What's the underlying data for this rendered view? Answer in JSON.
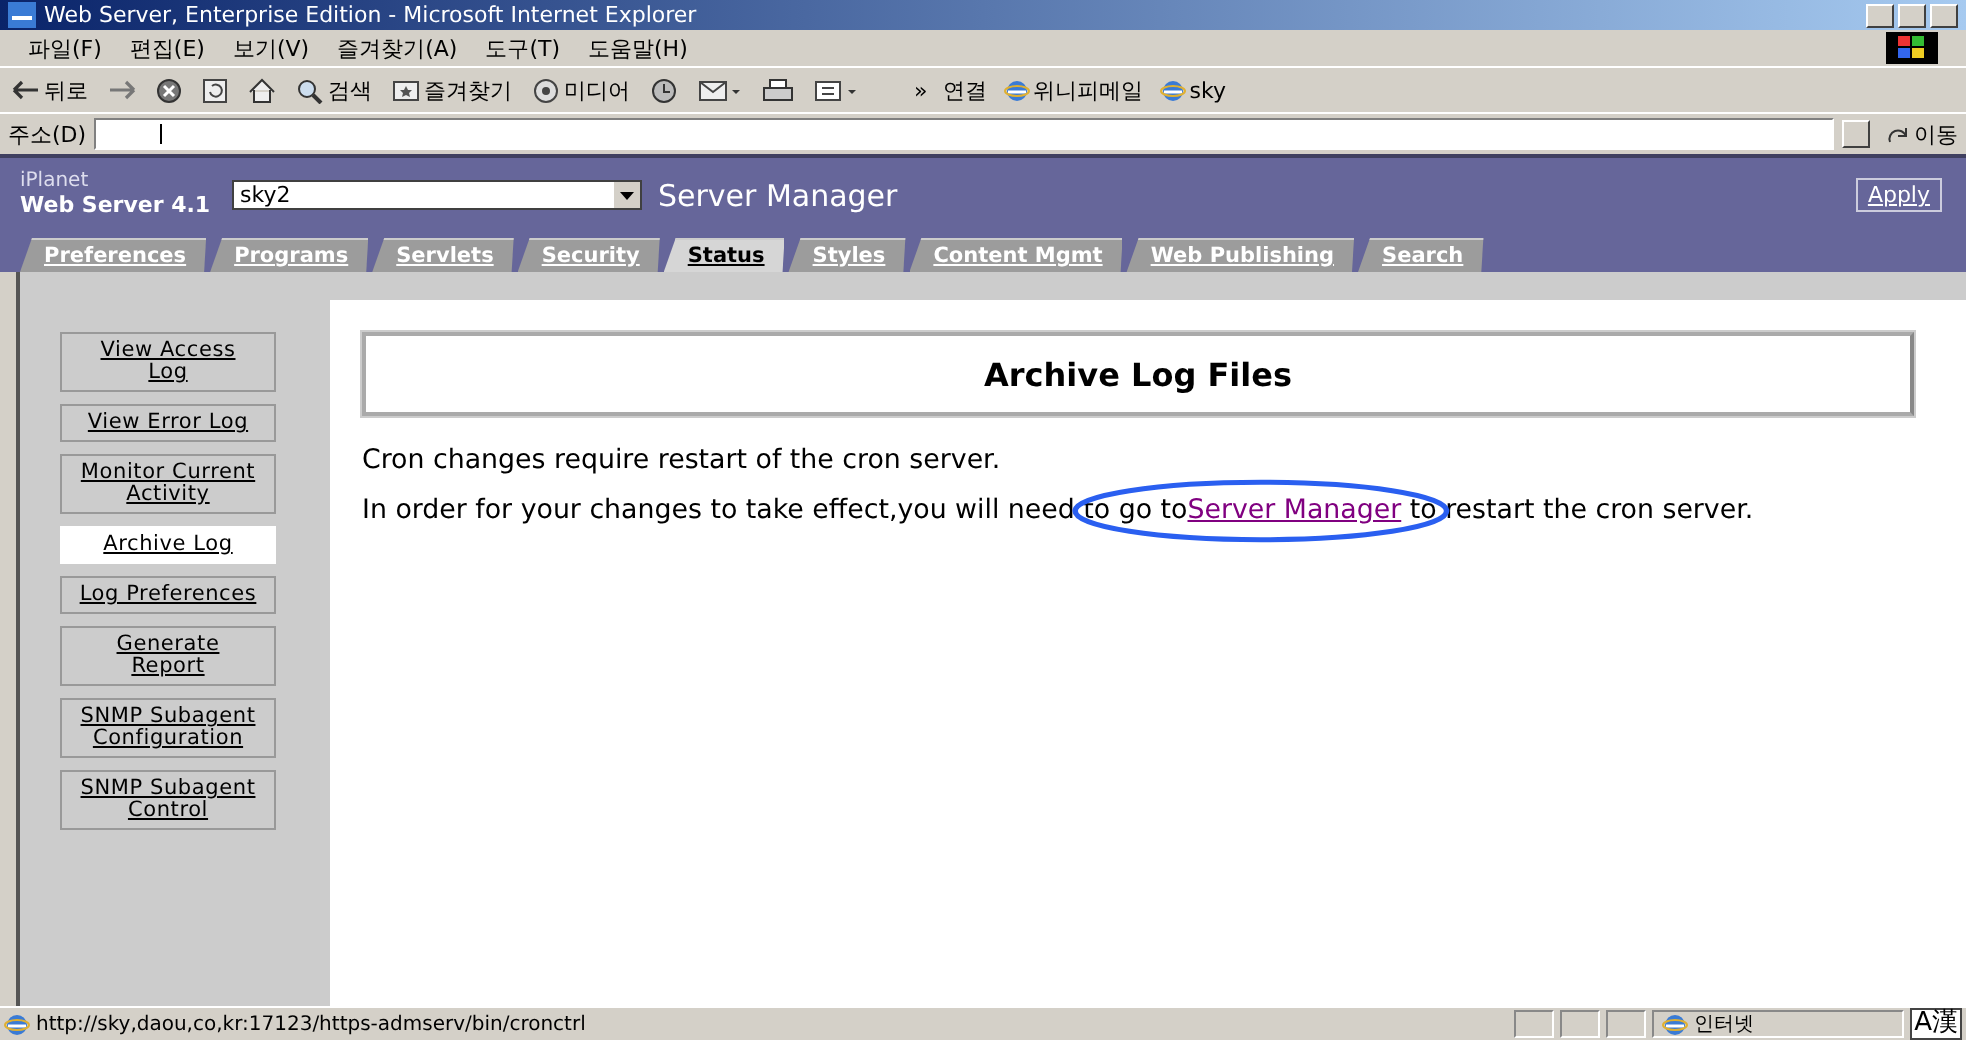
{
  "window": {
    "title": "Web Server, Enterprise Edition - Microsoft Internet Explorer"
  },
  "menu": [
    "파일(F)",
    "편집(E)",
    "보기(V)",
    "즐겨찾기(A)",
    "도구(T)",
    "도움말(H)"
  ],
  "toolbar": [
    {
      "kind": "back",
      "label": "뒤로"
    },
    {
      "kind": "forward"
    },
    {
      "kind": "stop"
    },
    {
      "kind": "refresh"
    },
    {
      "kind": "home"
    },
    {
      "kind": "search",
      "label": "검색"
    },
    {
      "kind": "favorites",
      "label": "즐겨찾기"
    },
    {
      "kind": "media",
      "label": "미디어"
    },
    {
      "kind": "history"
    },
    {
      "kind": "mail"
    },
    {
      "kind": "print"
    },
    {
      "kind": "edit"
    }
  ],
  "links": {
    "chevron": "»",
    "label": "연결",
    "items": [
      "위니피메일",
      "sky"
    ]
  },
  "address": {
    "label": "주소(D)",
    "go": "이동"
  },
  "header": {
    "brand": "iPlanet",
    "product": "Web Server 4.1",
    "server": "sky2",
    "title": "Server Manager",
    "apply": "Apply"
  },
  "tabs": [
    {
      "label": "Preferences",
      "selected": false
    },
    {
      "label": "Programs",
      "selected": false
    },
    {
      "label": "Servlets",
      "selected": false
    },
    {
      "label": "Security",
      "selected": false
    },
    {
      "label": "Status",
      "selected": true
    },
    {
      "label": "Styles",
      "selected": false
    },
    {
      "label": "Content Mgmt",
      "selected": false
    },
    {
      "label": "Web Publishing",
      "selected": false
    },
    {
      "label": "Search",
      "selected": false
    }
  ],
  "sidebar": [
    {
      "label": "View Access Log",
      "selected": false
    },
    {
      "label": "View Error Log",
      "selected": false
    },
    {
      "label": "Monitor Current Activity",
      "selected": false
    },
    {
      "label": "Archive Log",
      "selected": true
    },
    {
      "label": "Log Preferences",
      "selected": false
    },
    {
      "label": "Generate Report",
      "selected": false
    },
    {
      "label": "SNMP Subagent Configuration",
      "selected": false
    },
    {
      "label": "SNMP Subagent Control",
      "selected": false
    }
  ],
  "content": {
    "heading": "Archive Log Files",
    "note": "Cron changes require restart of the cron server.",
    "instruction_before": "In order for your changes to take effect,you will need to go to",
    "instruction_link": "Server Manager",
    "instruction_after": "to restart the cron server."
  },
  "status_bar": {
    "url": "http://sky,daou,co,kr:17123/https-admserv/bin/cronctrl",
    "zone": "인터넷",
    "ime": "A漢"
  }
}
